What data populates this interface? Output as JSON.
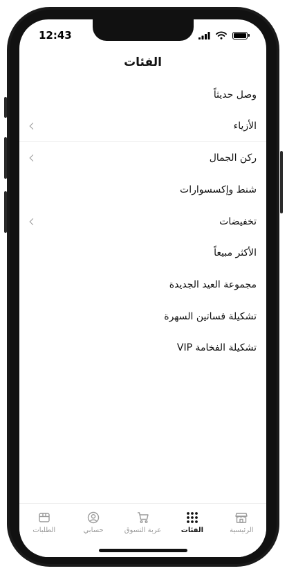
{
  "status_bar": {
    "time": "12:43"
  },
  "header": {
    "title": "الفئات"
  },
  "categories": [
    {
      "label": "وصل حديثاً",
      "has_chevron": false
    },
    {
      "label": "الأزياء",
      "has_chevron": true
    },
    {
      "label": "ركن الجمال",
      "has_chevron": true
    },
    {
      "label": "شنط وإكسسوارات",
      "has_chevron": false
    },
    {
      "label": "تخفيضات",
      "has_chevron": true
    },
    {
      "label": "الأكثر مبيعاً",
      "has_chevron": false
    },
    {
      "label": "مجموعة العيد الجديدة",
      "has_chevron": false
    },
    {
      "label": "تشكيلة فساتين السهرة",
      "has_chevron": false
    },
    {
      "label": "تشكيلة الفخامة VIP",
      "has_chevron": false
    }
  ],
  "tabbar": {
    "items": [
      {
        "label": "الطلبات",
        "icon": "box-icon",
        "active": false
      },
      {
        "label": "حسابي",
        "icon": "user-circle-icon",
        "active": false
      },
      {
        "label": "عربة التسوق",
        "icon": "cart-icon",
        "active": false
      },
      {
        "label": "الفئات",
        "icon": "grid-dots-icon",
        "active": true
      },
      {
        "label": "الرئيسية",
        "icon": "store-icon",
        "active": false
      }
    ]
  },
  "colors": {
    "text": "#111111",
    "inactive": "#9a9a9a",
    "divider": "#f0f0f0"
  }
}
